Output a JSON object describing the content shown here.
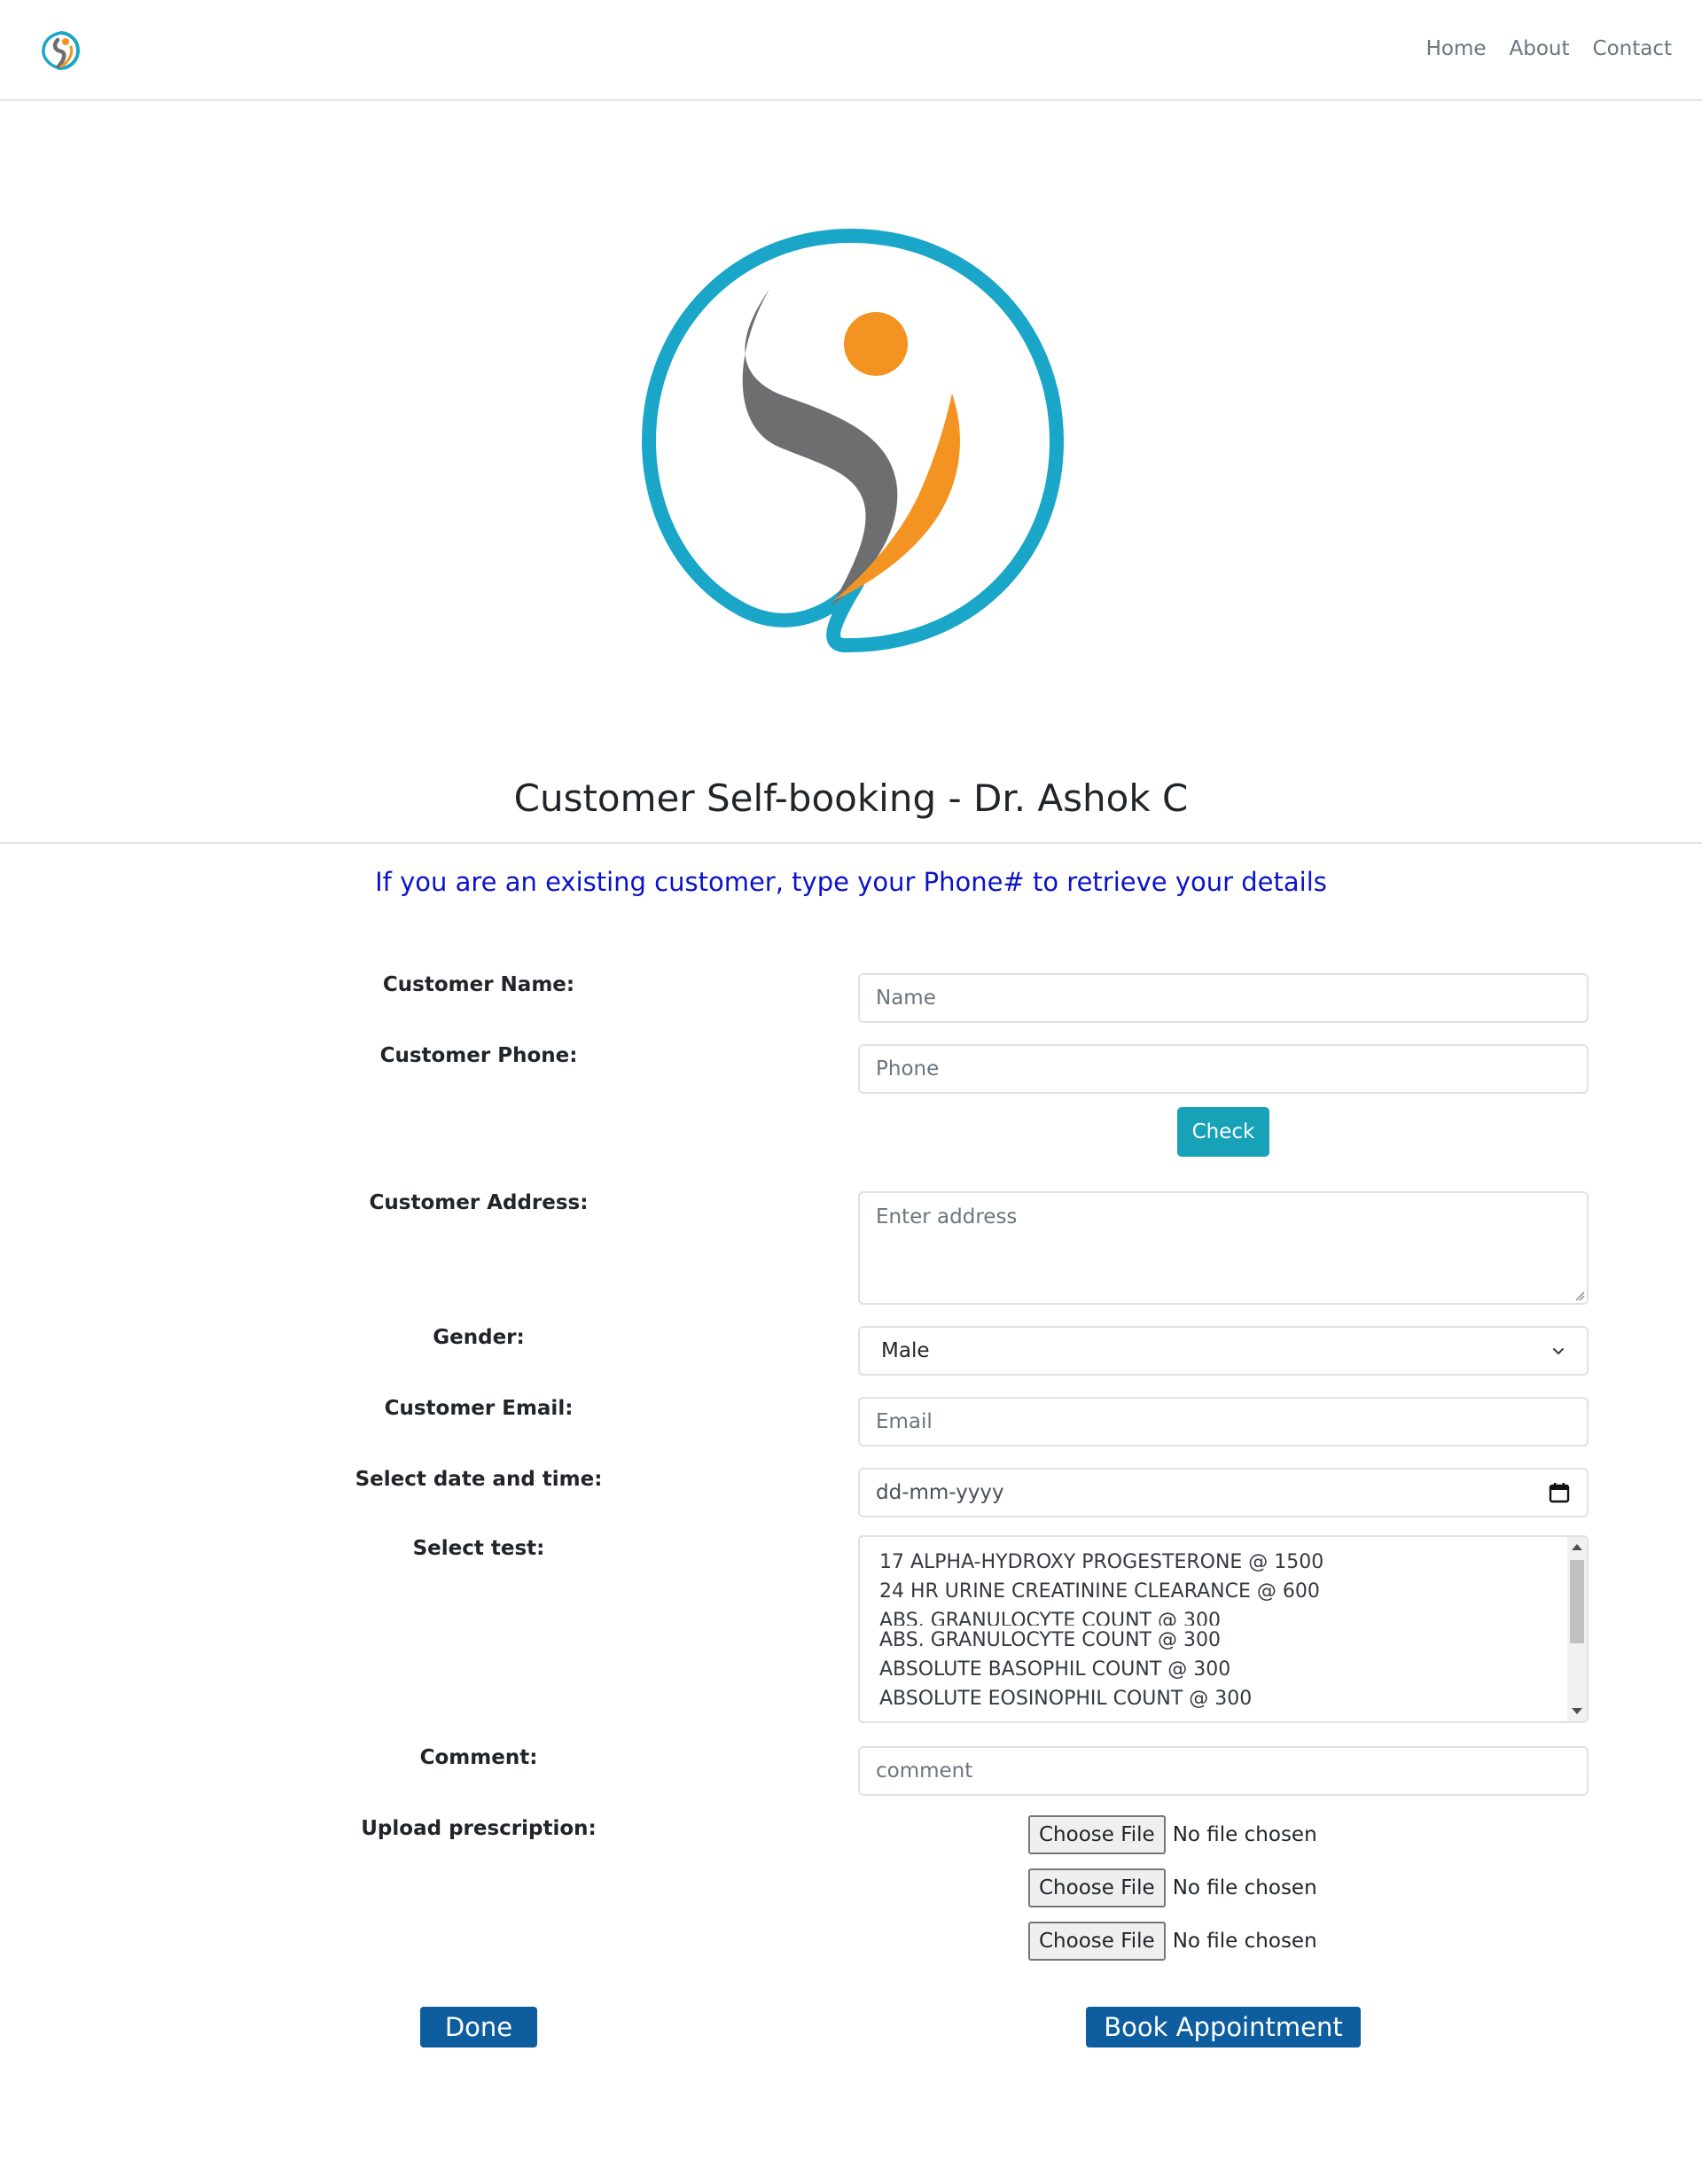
{
  "nav": {
    "links": [
      "Home",
      "About",
      "Contact"
    ]
  },
  "brand": {
    "ring_color": "#1aa6c9",
    "figure_color": "#6e6e70",
    "accent_color": "#f39321"
  },
  "page": {
    "title": "Customer Self-booking - Dr. Ashok C",
    "info": "If you are an existing customer, type your Phone# to retrieve your details"
  },
  "form": {
    "name": {
      "label": "Customer Name:",
      "placeholder": "Name",
      "value": ""
    },
    "phone": {
      "label": "Customer Phone:",
      "placeholder": "Phone",
      "value": ""
    },
    "check_label": "Check",
    "address": {
      "label": "Customer Address:",
      "placeholder": "Enter address",
      "value": ""
    },
    "gender": {
      "label": "Gender:",
      "value": "Male"
    },
    "email": {
      "label": "Customer Email:",
      "placeholder": "Email",
      "value": ""
    },
    "datetime": {
      "label": "Select date and time:",
      "placeholder": "dd-mm-yyyy"
    },
    "test": {
      "label": "Select test:",
      "options": [
        "17 ALPHA-HYDROXY PROGESTERONE @ 1500",
        "24 HR URINE CREATININE CLEARANCE @ 600",
        "ABS. GRANULOCYTE COUNT @ 300",
        "ABS. GRANULOCYTE COUNT @ 300",
        "ABSOLUTE BASOPHIL COUNT @ 300",
        "ABSOLUTE EOSINOPHIL COUNT @ 300"
      ]
    },
    "comment": {
      "label": "Comment:",
      "placeholder": "comment",
      "value": ""
    },
    "upload": {
      "label": "Upload prescription:",
      "files": [
        {
          "button": "Choose File",
          "status": "No file chosen"
        },
        {
          "button": "Choose File",
          "status": "No file chosen"
        },
        {
          "button": "Choose File",
          "status": "No file chosen"
        }
      ]
    }
  },
  "actions": {
    "done": "Done",
    "book": "Book Appointment"
  },
  "colors": {
    "info_text": "#0b13c9",
    "check_button": "#17a2b8",
    "action_button": "#0d5d9f"
  }
}
